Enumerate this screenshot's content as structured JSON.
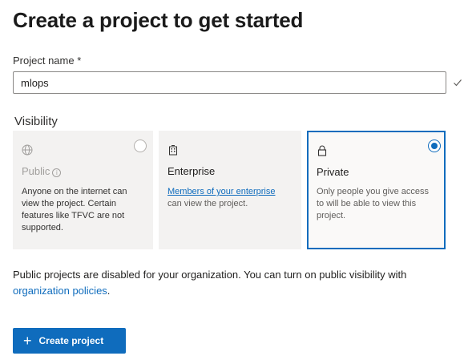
{
  "page": {
    "title": "Create a project to get started"
  },
  "project_name": {
    "label": "Project name *",
    "value": "mlops",
    "valid_icon": "checkmark-icon"
  },
  "visibility": {
    "label": "Visibility",
    "selected": "Private",
    "options": [
      {
        "icon": "globe-icon",
        "title": "Public",
        "info_icon": "info-icon",
        "info_glyph": "i",
        "description": "Anyone on the internet can view the project. Certain features like TFVC are not supported.",
        "disabled": true,
        "selected": false
      },
      {
        "icon": "building-icon",
        "title": "Enterprise",
        "link_text": "Members of your enterprise",
        "description_rest": " can view the project.",
        "disabled": false,
        "selected": false
      },
      {
        "icon": "lock-icon",
        "title": "Private",
        "description": "Only people you give access to will be able to view this project.",
        "disabled": false,
        "selected": true
      }
    ]
  },
  "notice": {
    "text": "Public projects are disabled for your organization. You can turn on public visibility with ",
    "link": "organization policies",
    "end": "."
  },
  "actions": {
    "create_icon": "plus-icon",
    "create_glyph": "+",
    "create_label": "Create project"
  },
  "colors": {
    "accent": "#0f6cbd",
    "card_bg": "#f3f2f1"
  }
}
